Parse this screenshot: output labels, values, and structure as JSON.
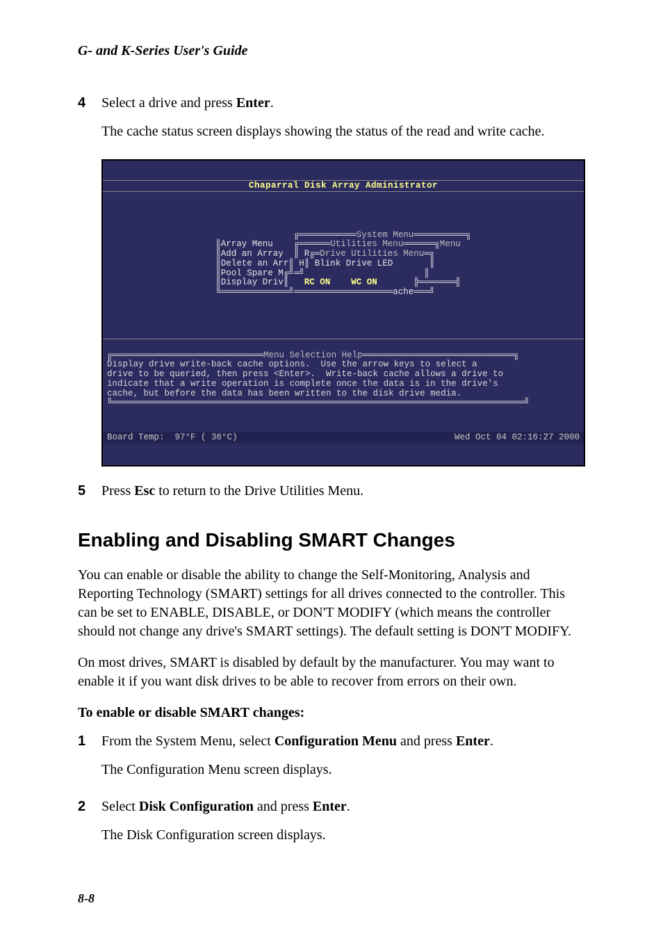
{
  "header": "G- and K-Series User's Guide",
  "step4": {
    "num": "4",
    "line1_pre": "Select a drive and press ",
    "line1_bold": "Enter",
    "line1_post": ".",
    "line2": "The cache status screen displays showing the status of the read and write cache."
  },
  "terminal": {
    "title": "Chaparral Disk Array Administrator",
    "menus": {
      "system_title": "System Menu",
      "array_menu": "Array Menu",
      "utilities_menu": "Utilities Menu",
      "menu_word": "Menu",
      "add_array": "Add an Array",
      "r_prefix": "R",
      "drive_util_menu": "Drive Utilities Menu",
      "delete_arr": "Delete an Arr",
      "h_prefix": "H",
      "blink_drive": "Blink Drive LED",
      "pool_spare": "Pool Spare M",
      "display_driv": "Display Driv",
      "rc_wc": "RC ON    WC ON",
      "ache": "ache"
    },
    "help_title": "Menu Selection Help",
    "help_body": "Display drive write-back cache options.  Use the arrow keys to select a\ndrive to be queried, then press <Enter>.  Write-back cache allows a drive to\nindicate that a write operation is complete once the data is in the drive's\ncache, but before the data has been written to the disk drive media.",
    "status_left": "Board Temp:  97°F ( 36°C)",
    "status_right": "Wed Oct 04 02:16:27 2000"
  },
  "step5": {
    "num": "5",
    "pre": "Press ",
    "bold": "Esc",
    "post": " to return to the Drive Utilities Menu."
  },
  "h2": "Enabling and Disabling SMART Changes",
  "para1": "You can enable or disable the ability to change the Self-Monitoring, Analysis and Reporting Technology (SMART) settings for all drives connected to the controller. This can be set to ENABLE, DISABLE, or DON'T MODIFY (which means the controller should not change any drive's SMART settings). The default setting is DON'T MODIFY.",
  "para2": "On most drives, SMART is disabled by default by the manufacturer. You may want to enable it if you want disk drives to be able to recover from errors on their own.",
  "subhead": "To enable or disable SMART changes:",
  "step1": {
    "num": "1",
    "line1_pre": "From the System Menu, select ",
    "line1_b1": "Configuration Menu",
    "line1_mid": " and press ",
    "line1_b2": "Enter",
    "line1_post": ".",
    "line2": "The Configuration Menu screen displays."
  },
  "step2": {
    "num": "2",
    "line1_pre": "Select ",
    "line1_b1": "Disk Configuration",
    "line1_mid": " and press ",
    "line1_b2": "Enter",
    "line1_post": ".",
    "line2": "The Disk Configuration screen displays."
  },
  "footer": "8-8"
}
